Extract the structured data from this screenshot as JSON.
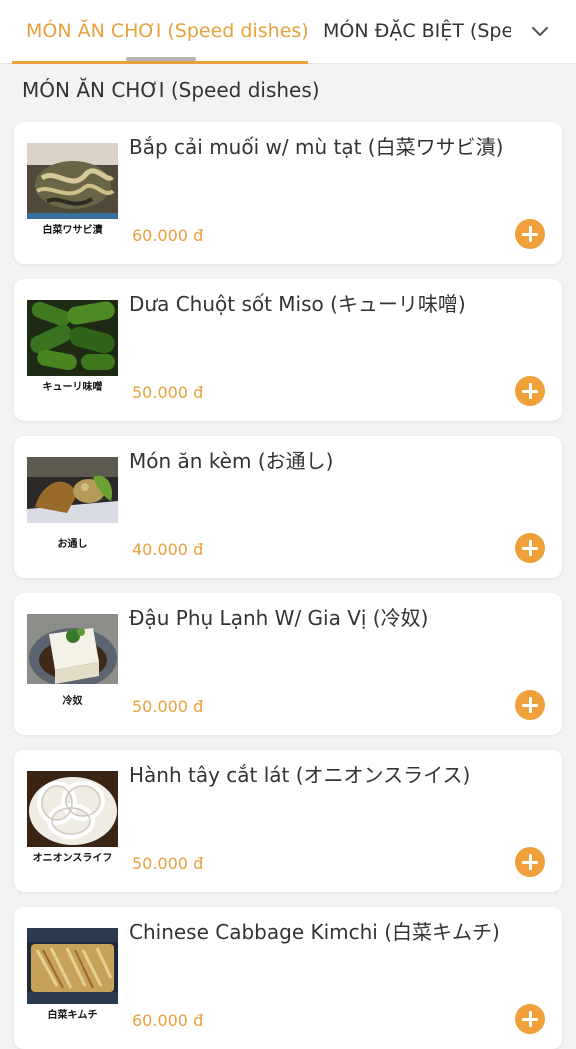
{
  "tabs": [
    {
      "label": "MÓN ĂN CHƠI (Speed dishes)",
      "active": true
    },
    {
      "label": "MÓN ĐẶC BIỆT (Special dishes)",
      "active": false
    }
  ],
  "section_title": "MÓN ĂN CHƠI (Speed dishes)",
  "items": [
    {
      "name": "Bắp cải muối w/ mù tạt (白菜ワサビ漬)",
      "price": "60.000 đ",
      "caption": "白菜ワサビ漬"
    },
    {
      "name": "Dưa Chuột sốt Miso (キューリ味噌)",
      "price": "50.000 đ",
      "caption": "キューリ味噌"
    },
    {
      "name": "Món ăn kèm (お通し)",
      "price": "40.000 đ",
      "caption": "お通し"
    },
    {
      "name": "Đậu Phụ Lạnh W/ Gia Vị (冷奴)",
      "price": "50.000 đ",
      "caption": "冷奴"
    },
    {
      "name": "Hành tây cắt lát (オニオンスライス)",
      "price": "50.000 đ",
      "caption": "オニオンスライフ"
    },
    {
      "name": "Chinese Cabbage Kimchi (白菜キムチ)",
      "price": "60.000 đ",
      "caption": "白菜キムチ"
    }
  ],
  "colors": {
    "accent": "#e8a13c",
    "add_button": "#f0a03a",
    "background": "#f3f3f3",
    "card": "#ffffff",
    "text": "#333333"
  },
  "icons": {
    "dropdown": "chevron-down-icon",
    "add": "plus-circle-icon"
  }
}
